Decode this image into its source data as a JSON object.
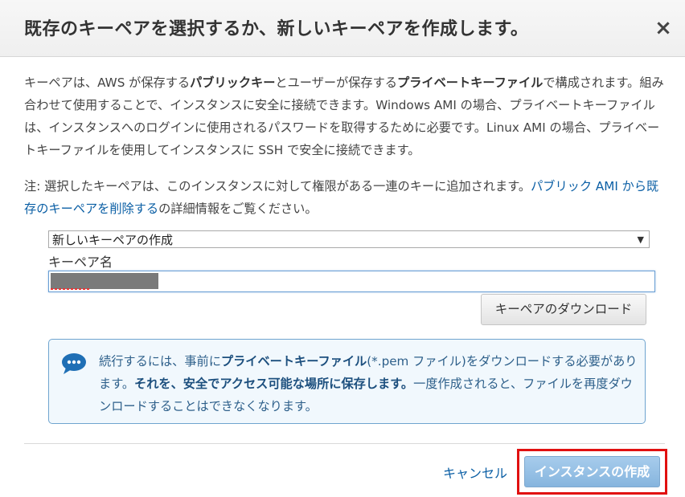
{
  "header": {
    "title": "既存のキーペアを選択するか、新しいキーペアを作成します。",
    "close_label": "×"
  },
  "intro": {
    "p1": "キーペアは、AWS が保存する",
    "p1_bold1": "パブリックキー",
    "p2": "とユーザーが保存する",
    "p2_bold2": "プライベートキーファイル",
    "p3": "で構成されます。組み合わせて使用することで、インスタンスに安全に接続できます。Windows AMI の場合、プライベートキーファイルは、インスタンスへのログインに使用されるパスワードを取得するために必要です。Linux AMI の場合、プライベートキーファイルを使用してインスタンスに SSH で安全に接続できます。"
  },
  "note": {
    "prefix": "注: 選択したキーペアは、このインスタンスに対して権限がある一連のキーに追加されます。",
    "link": "パブリック AMI から既存のキーペアを削除する",
    "suffix": "の詳細情報をご覧ください。"
  },
  "keypair_select": {
    "selected": "新しいキーペアの作成",
    "arrow": "▼"
  },
  "keypair_name": {
    "label": "キーペア名",
    "value": ""
  },
  "download_button": "キーペアのダウンロード",
  "info_box": {
    "t1": "続行するには、事前に",
    "t1_bold": "プライベートキーファイル",
    "t2": "(*.pem ファイル)をダウンロードする必要があります。",
    "t2_bold": "それを、安全でアクセス可能な場所に保存します。",
    "t3": "一度作成されると、ファイルを再度ダウンロードすることはできなくなります。"
  },
  "footer": {
    "cancel": "キャンセル",
    "create": "インスタンスの作成"
  },
  "colors": {
    "link": "#0b5fa5",
    "primary_button": "#86b5de",
    "highlight_box": "#e11010",
    "info_border": "#6fa4cf"
  }
}
